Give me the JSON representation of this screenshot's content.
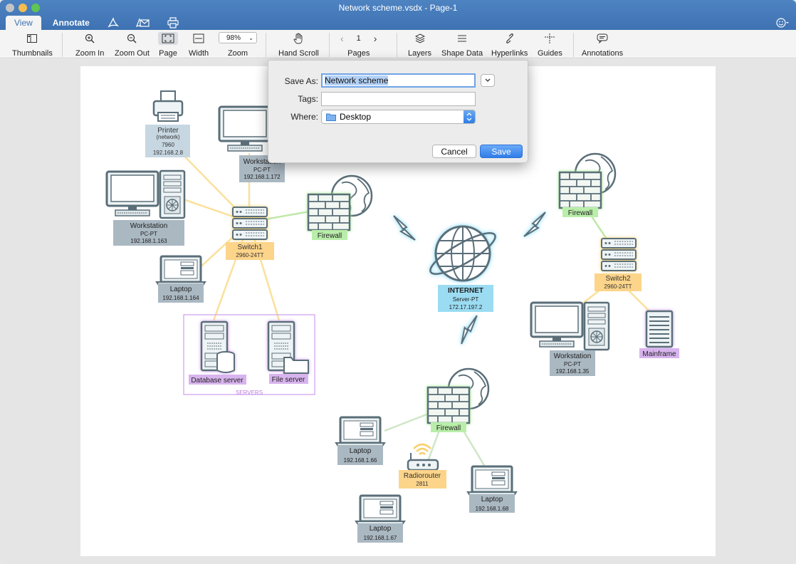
{
  "window": {
    "title": "Network scheme.vsdx - Page-1"
  },
  "tabs": {
    "view": "View",
    "annotate": "Annotate"
  },
  "toolbar": {
    "thumbnails": "Thumbnails",
    "zoom_in": "Zoom In",
    "zoom_out": "Zoom Out",
    "page": "Page",
    "width": "Width",
    "zoom": "Zoom",
    "zoom_value": "98%",
    "hand_scroll": "Hand Scroll",
    "pages": "Pages",
    "page_number": "1",
    "layers": "Layers",
    "shape_data": "Shape Data",
    "hyperlinks": "Hyperlinks",
    "guides": "Guides",
    "annotations": "Annotations"
  },
  "dialog": {
    "save_as_label": "Save As:",
    "save_as_value": "Network scheme",
    "tags_label": "Tags:",
    "tags_value": "",
    "where_label": "Where:",
    "where_value": "Desktop",
    "cancel": "Cancel",
    "save": "Save"
  },
  "diagram": {
    "printer": {
      "name": "Printer",
      "sub": "(network)",
      "model": "7960",
      "ip": "192.168.2.8"
    },
    "ws_top": {
      "name": "Workstation",
      "model": "PC-PT",
      "ip": "192.168.1.172"
    },
    "ws_left": {
      "name": "Workstation",
      "model": "PC-PT",
      "ip": "192.168.1.163"
    },
    "switch1": {
      "name": "Switch1",
      "model": "2960-24TT"
    },
    "laptop_left": {
      "name": "Laptop",
      "ip": "192.168.1.164"
    },
    "db_server": {
      "name": "Database server"
    },
    "file_server": {
      "name": "File server"
    },
    "servers_group": {
      "name": "SERVERS"
    },
    "firewall_left": {
      "name": "Firewall"
    },
    "internet": {
      "name": "INTERNET",
      "model": "Server-PT",
      "ip": "172.17.197.2"
    },
    "firewall_right": {
      "name": "Firewall"
    },
    "switch2": {
      "name": "Switch2",
      "model": "2960-24TT"
    },
    "ws_right": {
      "name": "Workstation",
      "model": "PC-PT",
      "ip": "192.168.1.35"
    },
    "mainframe": {
      "name": "Mainframe"
    },
    "firewall_bottom": {
      "name": "Firewall"
    },
    "laptop_b1": {
      "name": "Laptop",
      "ip": "192.168.1.66"
    },
    "radiorouter": {
      "name": "Radiorouter",
      "model": "2811"
    },
    "laptop_b2": {
      "name": "Laptop",
      "ip": "192.168.1.68"
    },
    "laptop_b3": {
      "name": "Laptop",
      "ip": "192.168.1.67"
    }
  },
  "colors": {
    "titlebar": "#4a7fc0",
    "switch_label": "#fcd48a",
    "firewall_label": "#b9eeaa",
    "server_label": "#d8b4ee",
    "internet_label": "#9bdcf2",
    "device_label": "#aab8c2",
    "printer_label": "#c7d7e2"
  }
}
